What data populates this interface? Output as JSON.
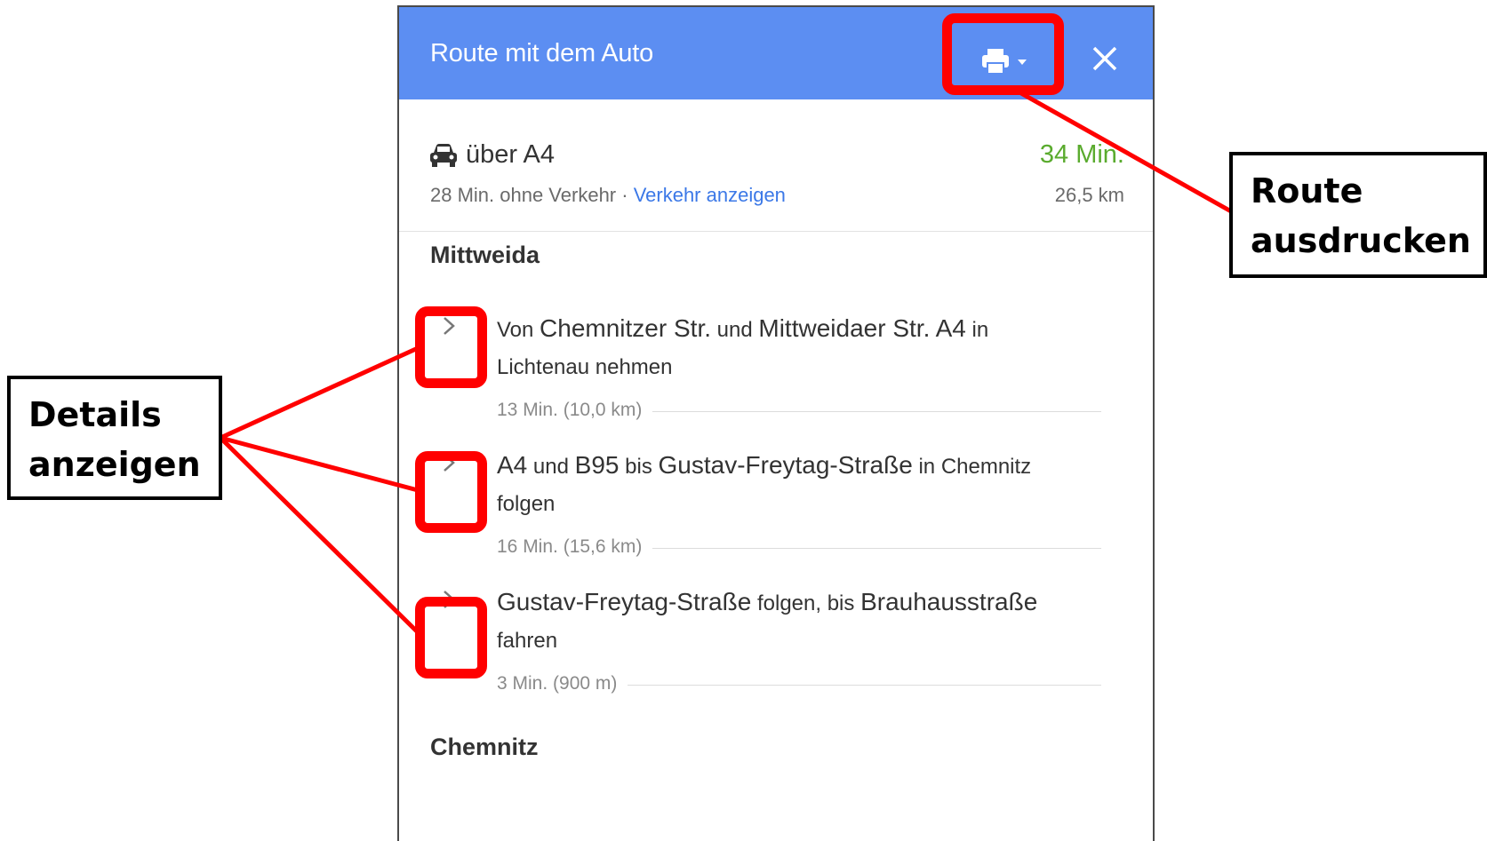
{
  "header": {
    "title": "Route mit dem Auto",
    "print_icon": "printer-icon",
    "close_icon": "close-icon"
  },
  "summary": {
    "via": "über A4",
    "duration": "34 Min.",
    "no_traffic": "28 Min. ohne Verkehr · ",
    "traffic_link": "Verkehr anzeigen",
    "distance": "26,5 km"
  },
  "places": {
    "start": "Mittweida",
    "next": "Chemnitz"
  },
  "steps": [
    {
      "p1": "Von ",
      "p2": "Chemnitzer Str.",
      "p3": " und ",
      "p4": "Mittweidaer Str. A4",
      "p5": " in ",
      "p6": "Lichtenau nehmen",
      "meta": "13 Min. (10,0 km)"
    },
    {
      "p1": "A4",
      "p2": " und ",
      "p3": "B95",
      "p4": " bis ",
      "p5": "Gustav-Freytag-Straße",
      "p6": " in Chemnitz",
      "p7": "folgen",
      "meta": "16 Min. (15,6 km)"
    },
    {
      "p1": "Gustav-Freytag-Straße",
      "p2": " folgen, bis ",
      "p3": "Brauhausstraße",
      "p4": "fahren",
      "meta": "3 Min. (900 m)"
    }
  ],
  "annotations": {
    "print": {
      "line1": "Route",
      "line2": "ausdrucken"
    },
    "details": {
      "line1": "Details",
      "line2": "anzeigen"
    },
    "color": "#ff0000"
  }
}
